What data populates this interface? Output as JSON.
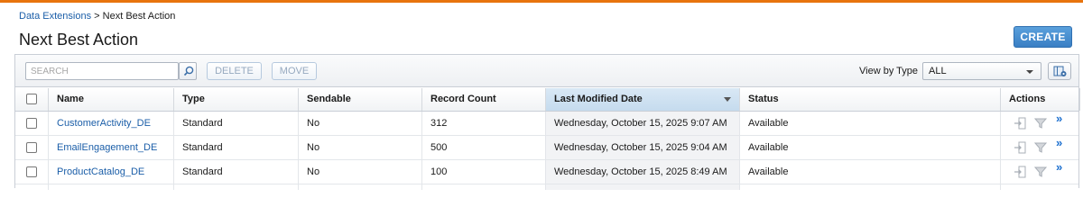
{
  "breadcrumb": {
    "parent": "Data Extensions",
    "separator": ">",
    "current": "Next Best Action"
  },
  "page": {
    "title": "Next Best Action",
    "create_label": "CREATE"
  },
  "toolbar": {
    "search_placeholder": "SEARCH",
    "delete_label": "DELETE",
    "move_label": "MOVE",
    "view_by_label": "View by Type",
    "view_by_value": "ALL"
  },
  "table": {
    "columns": [
      "Name",
      "Type",
      "Sendable",
      "Record Count",
      "Last Modified Date",
      "Status",
      "Actions"
    ],
    "sorted_column": "Last Modified Date",
    "rows": [
      {
        "name": "CustomerActivity_DE",
        "type": "Standard",
        "sendable": "No",
        "record_count": "312",
        "modified": "Wednesday, October 15, 2025 9:07 AM",
        "status": "Available"
      },
      {
        "name": "EmailEngagement_DE",
        "type": "Standard",
        "sendable": "No",
        "record_count": "500",
        "modified": "Wednesday, October 15, 2025 9:04 AM",
        "status": "Available"
      },
      {
        "name": "ProductCatalog_DE",
        "type": "Standard",
        "sendable": "No",
        "record_count": "100",
        "modified": "Wednesday, October 15, 2025 8:49 AM",
        "status": "Available"
      }
    ],
    "row_actions": [
      "import-icon",
      "filter-icon",
      "more-icon"
    ],
    "more_glyph": "»"
  },
  "colors": {
    "accent_bar": "#e8740e",
    "link": "#1b5ea8",
    "create_button": "#3a7fc4"
  }
}
